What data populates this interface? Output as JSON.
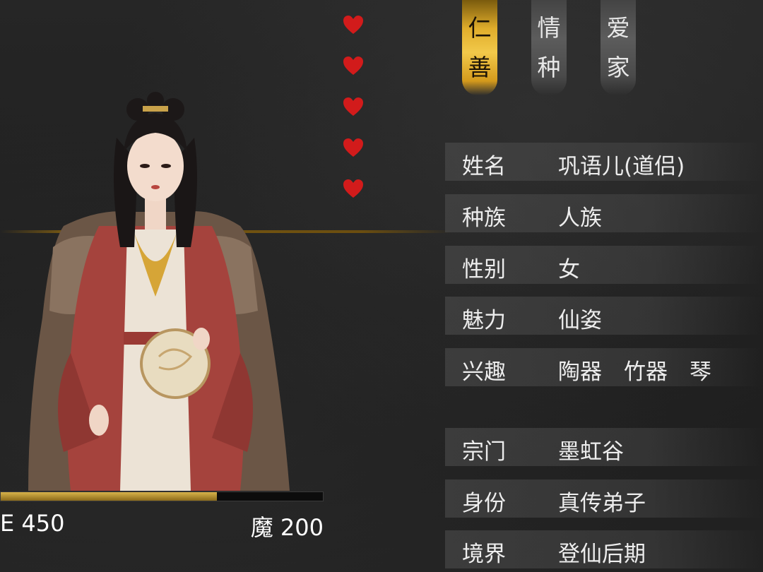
{
  "tabs": [
    {
      "label": "仁善",
      "active": true
    },
    {
      "label": "情种",
      "active": false
    },
    {
      "label": "爱家",
      "active": false
    }
  ],
  "hearts": {
    "count": 5,
    "color": "#d21b1b"
  },
  "info_rows": [
    {
      "label": "姓名",
      "value": "巩语儿(道侣)"
    },
    {
      "label": "种族",
      "value": "人族"
    },
    {
      "label": "性别",
      "value": "女"
    },
    {
      "label": "魅力",
      "value": "仙姿"
    },
    {
      "label": "兴趣",
      "value": "陶器　竹器　琴"
    },
    {
      "label": "宗门",
      "value": "墨虹谷"
    },
    {
      "label": "身份",
      "value": "真传弟子"
    },
    {
      "label": "境界",
      "value": "登仙后期"
    }
  ],
  "stats": {
    "left_label": "E 450",
    "right_label": "魔 200",
    "bar_fill_ratio": 0.67
  },
  "colors": {
    "accent_gold": "#f2c94a",
    "heart_red": "#d21b1b"
  }
}
